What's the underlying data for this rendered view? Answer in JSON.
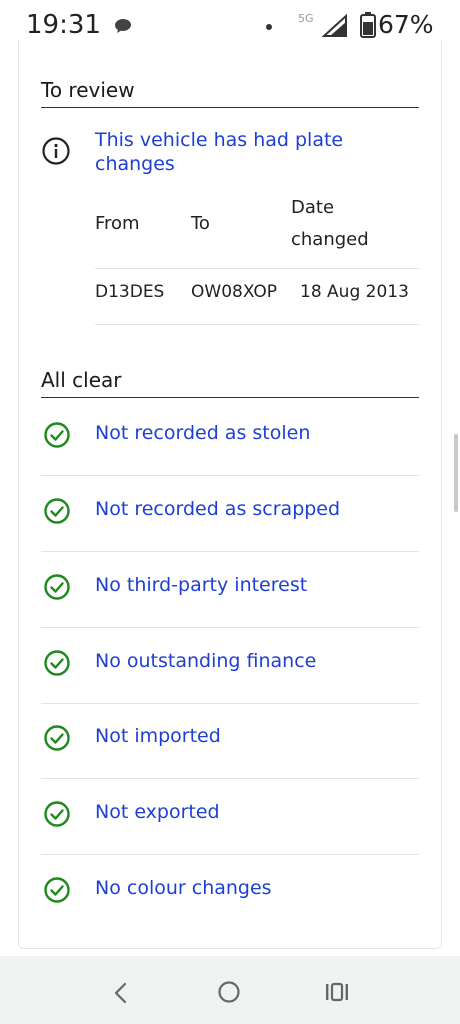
{
  "status_bar": {
    "time": "19:31",
    "network": "5G",
    "battery": "67%",
    "icons": [
      "chat-icon",
      "dot-icon",
      "signal-icon",
      "battery-icon"
    ]
  },
  "review": {
    "title": "To review",
    "link": "This vehicle has had plate changes",
    "table": {
      "headers": [
        "From",
        "To",
        "Date changed"
      ],
      "rows": [
        [
          "D13DES",
          "OW08XOP",
          "18 Aug 2013"
        ]
      ]
    }
  },
  "all_clear": {
    "title": "All clear",
    "items": [
      {
        "label": "Not recorded as stolen"
      },
      {
        "label": "Not recorded as scrapped"
      },
      {
        "label": "No third-party interest"
      },
      {
        "label": "No outstanding finance"
      },
      {
        "label": "Not imported"
      },
      {
        "label": "Not exported"
      },
      {
        "label": "No colour changes"
      }
    ]
  },
  "nav_bar": {
    "buttons": [
      "back-icon",
      "home-icon",
      "recents-icon"
    ]
  },
  "colors": {
    "link": "#1d3fd6",
    "check": "#1e8a1e",
    "text": "#1a1a1a"
  }
}
